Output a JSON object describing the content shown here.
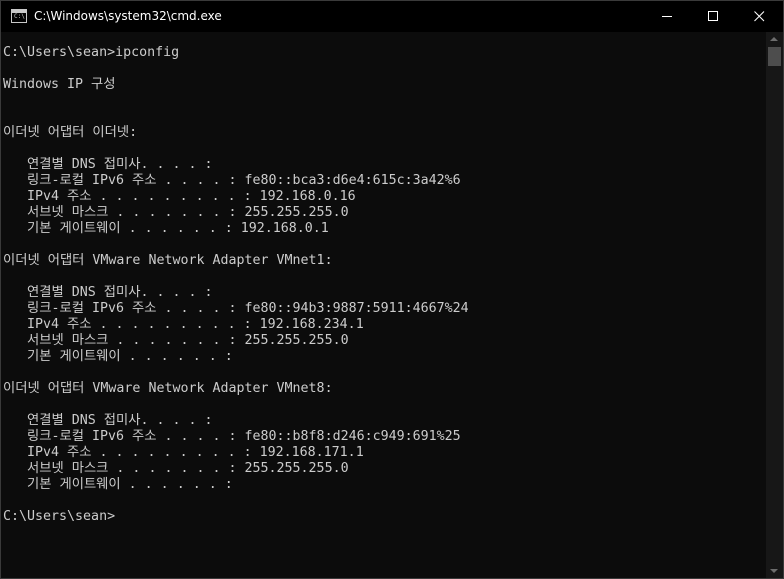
{
  "window": {
    "title": "C:\\Windows\\system32\\cmd.exe",
    "icon": "cmd-icon",
    "icon_text": "C:\\",
    "controls": [
      "minimize-icon",
      "maximize-icon",
      "close-icon"
    ]
  },
  "console": {
    "lines": [
      "C:\\Users\\sean>ipconfig",
      "",
      "Windows IP 구성",
      "",
      "",
      "이더넷 어댑터 이더넷:",
      "",
      "   연결별 DNS 접미사. . . . :",
      "   링크-로컬 IPv6 주소 . . . . : fe80::bca3:d6e4:615c:3a42%6",
      "   IPv4 주소 . . . . . . . . . : 192.168.0.16",
      "   서브넷 마스크 . . . . . . . : 255.255.255.0",
      "   기본 게이트웨이 . . . . . . : 192.168.0.1",
      "",
      "이더넷 어댑터 VMware Network Adapter VMnet1:",
      "",
      "   연결별 DNS 접미사. . . . :",
      "   링크-로컬 IPv6 주소 . . . . : fe80::94b3:9887:5911:4667%24",
      "   IPv4 주소 . . . . . . . . . : 192.168.234.1",
      "   서브넷 마스크 . . . . . . . : 255.255.255.0",
      "   기본 게이트웨이 . . . . . . :",
      "",
      "이더넷 어댑터 VMware Network Adapter VMnet8:",
      "",
      "   연결별 DNS 접미사. . . . :",
      "   링크-로컬 IPv6 주소 . . . . : fe80::b8f8:d246:c949:691%25",
      "   IPv4 주소 . . . . . . . . . : 192.168.171.1",
      "   서브넷 마스크 . . . . . . . : 255.255.255.0",
      "   기본 게이트웨이 . . . . . . :",
      "",
      "C:\\Users\\sean>"
    ]
  },
  "colors": {
    "background": "#0c0c0c",
    "text": "#cccccc",
    "titlebar": "#000000",
    "scrollbar_track": "#171717",
    "scrollbar_thumb": "#4d4d4d"
  }
}
